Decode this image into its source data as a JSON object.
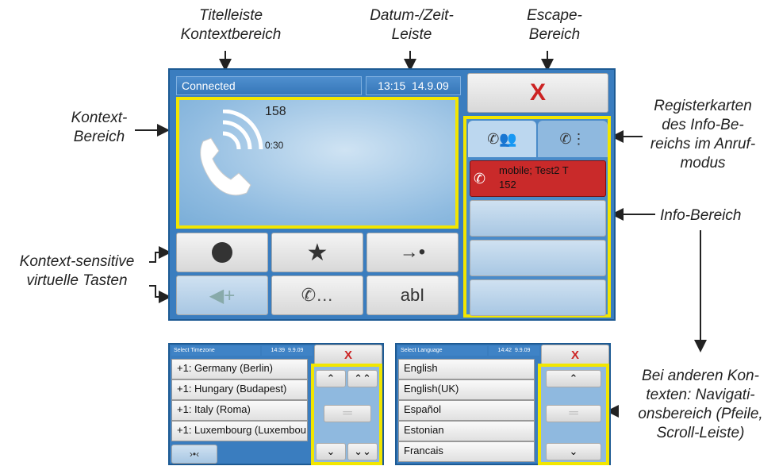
{
  "annotations": {
    "title_area": "Titelleiste\nKontextbereich",
    "datetime": "Datum-/Zeit-\nLeiste",
    "escape": "Escape-\nBereich",
    "context": "Kontext-\nBereich",
    "tabs": "Registerkarten\ndes Info-Be-\nreichs im Anruf-\nmodus",
    "info": "Info-Bereich",
    "keys": "Kontext-sensitive\nvirtuelle Tasten",
    "nav": "Bei anderen Kon-\ntexten: Navigati-\nonsbereich (Pfeile,\nScroll-Leiste)"
  },
  "main_screen": {
    "status": "Connected",
    "time": "13:15",
    "date": "14.9.09",
    "escape_label": "X",
    "call_number": "158",
    "call_duration": "0:30",
    "info_call_line1": "mobile; Test2 T",
    "info_call_line2": "152",
    "soft_keys": [
      "●",
      "★",
      "→●",
      "◀+",
      "📞...",
      "abI"
    ]
  },
  "timezone_screen": {
    "title": "Select Timezone",
    "time": "14:39",
    "date": "9.9.09",
    "escape_label": "X",
    "items": [
      "+1: Germany (Berlin)",
      "+1: Hungary (Budapest)",
      "+1: Italy (Roma)",
      "+1: Luxembourg (Luxembou"
    ],
    "bottom_key": "›•‹"
  },
  "language_screen": {
    "title": "Select Language",
    "time": "14:42",
    "date": "9.9.09",
    "escape_label": "X",
    "items": [
      "English",
      "English(UK)",
      "Español",
      "Estonian",
      "Francais"
    ]
  },
  "colors": {
    "yellow": "#f2e600",
    "screen_blue": "#2a6fb0",
    "escape_red": "#cc2222",
    "call_red": "#c92a2a"
  }
}
